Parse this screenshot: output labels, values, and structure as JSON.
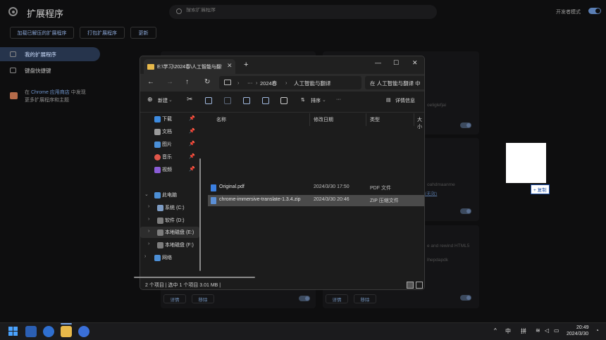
{
  "chrome": {
    "page_title": "扩展程序",
    "search_placeholder": "搜索扩展程序",
    "dev_mode_label": "开发者模式",
    "toolbar": {
      "load_unpacked": "加载已解压的扩展程序",
      "pack_extension": "打包扩展程序",
      "update": "更新"
    },
    "sidebar": {
      "items": [
        {
          "label": "我的扩展程序"
        },
        {
          "label": "键盘快捷键"
        }
      ],
      "store_prefix": "在",
      "store_link": "Chrome 应用商店",
      "store_suffix": "中发现",
      "store_line2": "更多扩展程序和主题"
    },
    "cards": {
      "fragment1": "oeliglefjai",
      "fragment2": "oahdmaanme",
      "fragment3": "(无效)",
      "fragment4": "e and rewind HTML5",
      "fragment5": "lhepdapdk",
      "details_label": "详情",
      "remove_label": "移除"
    },
    "drag_copy_tip": "+ 复制"
  },
  "explorer": {
    "tab_title": "E:\\学习\\2024春\\人工智能与翻译",
    "address_crumbs": [
      "···",
      "2024春",
      "人工智能与翻译"
    ],
    "search_placeholder": "在 人工智能与翻译 中",
    "commands": {
      "new": "新建",
      "sort": "排序",
      "more": "···",
      "details": "详情信息"
    },
    "nav": {
      "quick": [
        {
          "label": "下载",
          "color": "#3d8be0"
        },
        {
          "label": "文档",
          "color": "#9a9a9a"
        },
        {
          "label": "图片",
          "color": "#4a90d9"
        },
        {
          "label": "音乐",
          "color": "#e0564a"
        },
        {
          "label": "视频",
          "color": "#8a5cd6"
        }
      ],
      "this_pc": "此电脑",
      "drives": [
        {
          "label": "系统 (C:)"
        },
        {
          "label": "软件 (D:)"
        },
        {
          "label": "本地磁盘 (E:)"
        },
        {
          "label": "本地磁盘 (F:)"
        }
      ],
      "network": "网络"
    },
    "columns": {
      "name": "名称",
      "modified": "修改日期",
      "type": "类型",
      "size": "大小"
    },
    "files": [
      {
        "name": "Original.pdf",
        "modified": "2024/3/30 17:50",
        "type": "PDF 文件"
      },
      {
        "name": "chrome-immersive-translate-1.3.4.zip",
        "modified": "2024/3/30 20:46",
        "type": "ZIP 压缩文件"
      }
    ],
    "status": "2 个项目  |  选中 1 个项目  3.01 MB  |"
  },
  "taskbar": {
    "ime_lang": "中",
    "ime_mode": "拼",
    "time": "20:49",
    "date": "2024/3/30"
  }
}
